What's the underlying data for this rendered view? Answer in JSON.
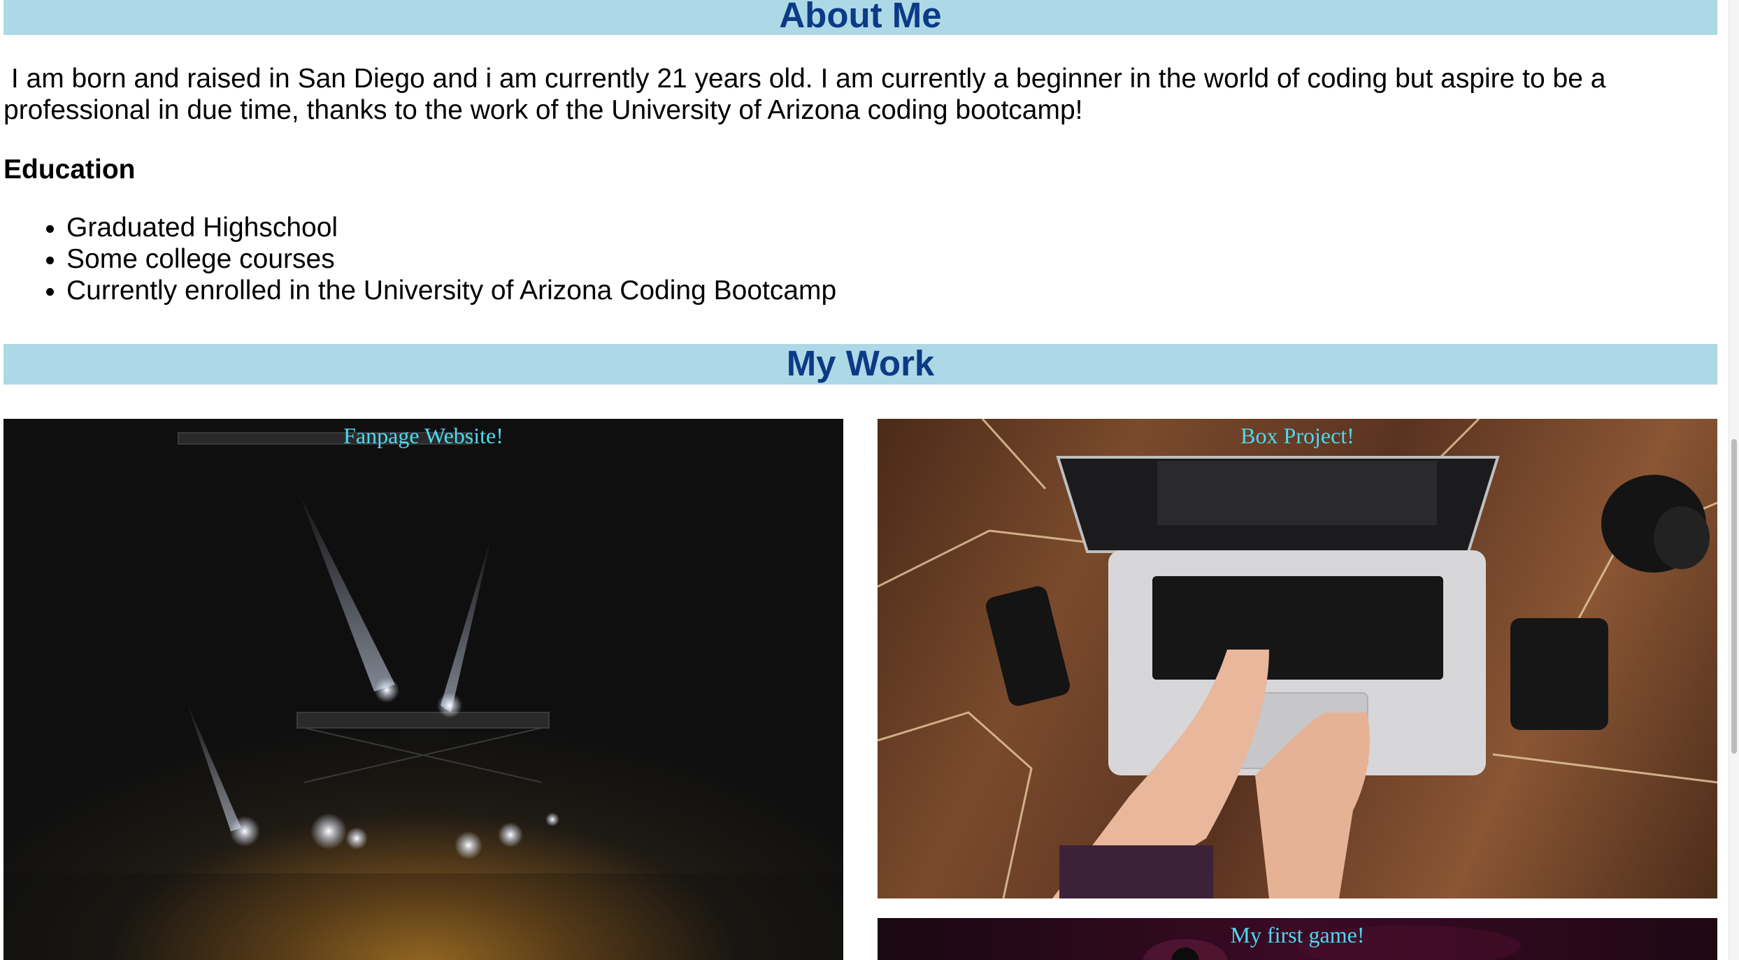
{
  "about": {
    "heading": "About Me",
    "intro": "I am born and raised in San Diego and i am currently 21 years old. I am currently a beginner in the world of coding but aspire to be a professional in due time, thanks to the work of the University of Arizona coding bootcamp!"
  },
  "education": {
    "heading": "Education",
    "items": [
      "Graduated Highschool",
      "Some college courses",
      "Currently enrolled in the University of Arizona Coding Bootcamp"
    ]
  },
  "work": {
    "heading": "My Work",
    "projects": [
      {
        "title": "Fanpage Website!",
        "image": "concert-stage-lights-photo"
      },
      {
        "title": "Box Project!",
        "image": "laptop-typing-on-wooden-desk-photo"
      },
      {
        "title": "My first game!",
        "image": "dark-magenta-photo"
      }
    ]
  },
  "colors": {
    "band_background": "#add8e6",
    "heading_text": "#0b3a86",
    "caption_text": "#4fd8f2"
  }
}
